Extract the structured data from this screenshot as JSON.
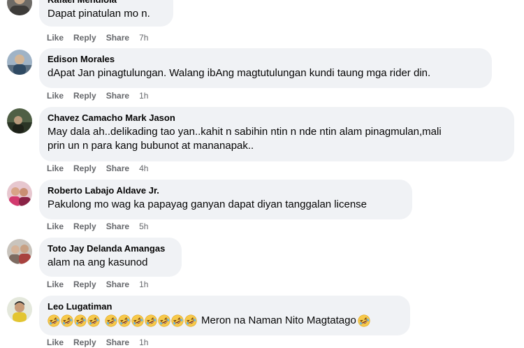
{
  "icons": {
    "laugh_emoji": "rolling-on-floor-laughing-emoji"
  },
  "comments": [
    {
      "author": "Rafael Mendiola",
      "lines": [
        "Dapat pinatulan mo n."
      ],
      "actions": {
        "like": "Like",
        "reply": "Reply",
        "share": "Share",
        "time": "7h"
      }
    },
    {
      "author": "Edison Morales",
      "lines": [
        "dApat Jan pinagtulungan. Walang ibAng magtutulungan kundi taung mga rider din."
      ],
      "actions": {
        "like": "Like",
        "reply": "Reply",
        "share": "Share",
        "time": "1h"
      }
    },
    {
      "author": "Chavez Camacho Mark Jason",
      "lines": [
        "May dala ah..delikading tao yan..kahit n sabihin ntin n nde ntin alam pinagmulan,mali",
        "prin un n para kang bubunot at mananapak.."
      ],
      "actions": {
        "like": "Like",
        "reply": "Reply",
        "share": "Share",
        "time": "4h"
      }
    },
    {
      "author": "Roberto Labajo Aldave Jr.",
      "lines": [
        "Pakulong mo wag ka papayag ganyan dapat diyan tanggalan license"
      ],
      "actions": {
        "like": "Like",
        "reply": "Reply",
        "share": "Share",
        "time": "5h"
      }
    },
    {
      "author": "Toto Jay Delanda Amangas",
      "lines": [
        "alam na ang kasunod"
      ],
      "actions": {
        "like": "Like",
        "reply": "Reply",
        "share": "Share",
        "time": "1h"
      }
    },
    {
      "author": "Leo Lugatiman",
      "text": "Meron na Naman Nito Magtatago",
      "emoji_groups": [
        4,
        7
      ],
      "actions": {
        "like": "Like",
        "reply": "Reply",
        "share": "Share",
        "time": "1h"
      }
    }
  ]
}
